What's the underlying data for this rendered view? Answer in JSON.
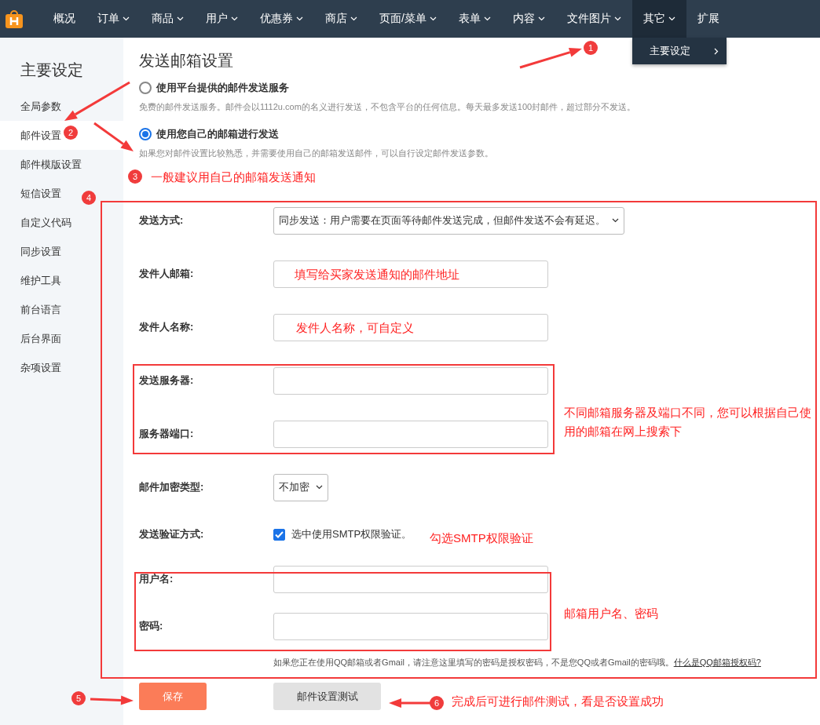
{
  "nav": {
    "items": [
      {
        "label": "概况",
        "dropdown": false,
        "selected": false
      },
      {
        "label": "订单",
        "dropdown": true,
        "selected": false
      },
      {
        "label": "商品",
        "dropdown": true,
        "selected": false
      },
      {
        "label": "用户",
        "dropdown": true,
        "selected": false
      },
      {
        "label": "优惠券",
        "dropdown": true,
        "selected": false
      },
      {
        "label": "商店",
        "dropdown": true,
        "selected": false
      },
      {
        "label": "页面/菜单",
        "dropdown": true,
        "selected": false
      },
      {
        "label": "表单",
        "dropdown": true,
        "selected": false
      },
      {
        "label": "内容",
        "dropdown": true,
        "selected": false
      },
      {
        "label": "文件图片",
        "dropdown": true,
        "selected": false
      },
      {
        "label": "其它",
        "dropdown": true,
        "selected": true,
        "menu": [
          {
            "label": "主要设定"
          }
        ]
      },
      {
        "label": "扩展",
        "dropdown": false,
        "selected": false
      }
    ]
  },
  "sidebar": {
    "title": "主要设定",
    "items": [
      {
        "label": "全局参数",
        "selected": false
      },
      {
        "label": "邮件设置",
        "selected": true
      },
      {
        "label": "邮件模版设置",
        "selected": false
      },
      {
        "label": "短信设置",
        "selected": false
      },
      {
        "label": "自定义代码",
        "selected": false
      },
      {
        "label": "同步设置",
        "selected": false
      },
      {
        "label": "维护工具",
        "selected": false
      },
      {
        "label": "前台语言",
        "selected": false
      },
      {
        "label": "后台界面",
        "selected": false
      },
      {
        "label": "杂项设置",
        "selected": false
      }
    ]
  },
  "page_title": "发送邮箱设置",
  "mail_options": [
    {
      "label": "使用平台提供的邮件发送服务",
      "description": "免费的邮件发送服务。邮件会以1112u.com的名义进行发送，不包含平台的任何信息。每天最多发送100封邮件，超过部分不发送。",
      "selected": false
    },
    {
      "label": "使用您自己的邮箱进行发送",
      "description": "如果您对邮件设置比较熟悉，并需要使用自己的邮箱发送邮件，可以自行设定邮件发送参数。",
      "selected": true
    }
  ],
  "form": {
    "rows": [
      {
        "kind": "select",
        "label": "发送方式:",
        "value": "同步发送：用户需要在页面等待邮件发送完成，但邮件发送不会有延迟。"
      },
      {
        "kind": "input",
        "label": "发件人邮箱:"
      },
      {
        "kind": "input",
        "label": "发件人名称:"
      },
      {
        "kind": "input",
        "label": "发送服务器:"
      },
      {
        "kind": "input",
        "label": "服务器端口:"
      },
      {
        "kind": "select",
        "label": "邮件加密类型:",
        "value": "不加密"
      },
      {
        "kind": "checkbox",
        "label": "发送验证方式:",
        "value": "选中使用SMTP权限验证。",
        "checked": true
      },
      {
        "kind": "input",
        "label": "用户名:"
      },
      {
        "kind": "input",
        "label": "密码:"
      }
    ],
    "hint": {
      "text": "如果您正在使用QQ邮箱或者Gmail，请注意这里填写的密码是授权密码，不是您QQ或者Gmail的密码哦。",
      "link": "什么是QQ邮箱授权码?"
    }
  },
  "buttons": [
    {
      "label": "保存",
      "kind": "primary"
    },
    {
      "label": "邮件设置测试",
      "kind": "secondary"
    }
  ],
  "annotations": {
    "badges": [
      "1",
      "2",
      "3",
      "4",
      "5",
      "6"
    ],
    "notes": [
      "一般建议用自己的邮箱发送通知",
      "填写给买家发送通知的邮件地址",
      "发件人名称，可自定义",
      "不同邮箱服务器及端口不同，您可以根据自己使用的邮箱在网上搜索下",
      "勾选SMTP权限验证",
      "邮箱用户名、密码",
      "完成后可进行邮件测试，看是否设置成功"
    ]
  }
}
